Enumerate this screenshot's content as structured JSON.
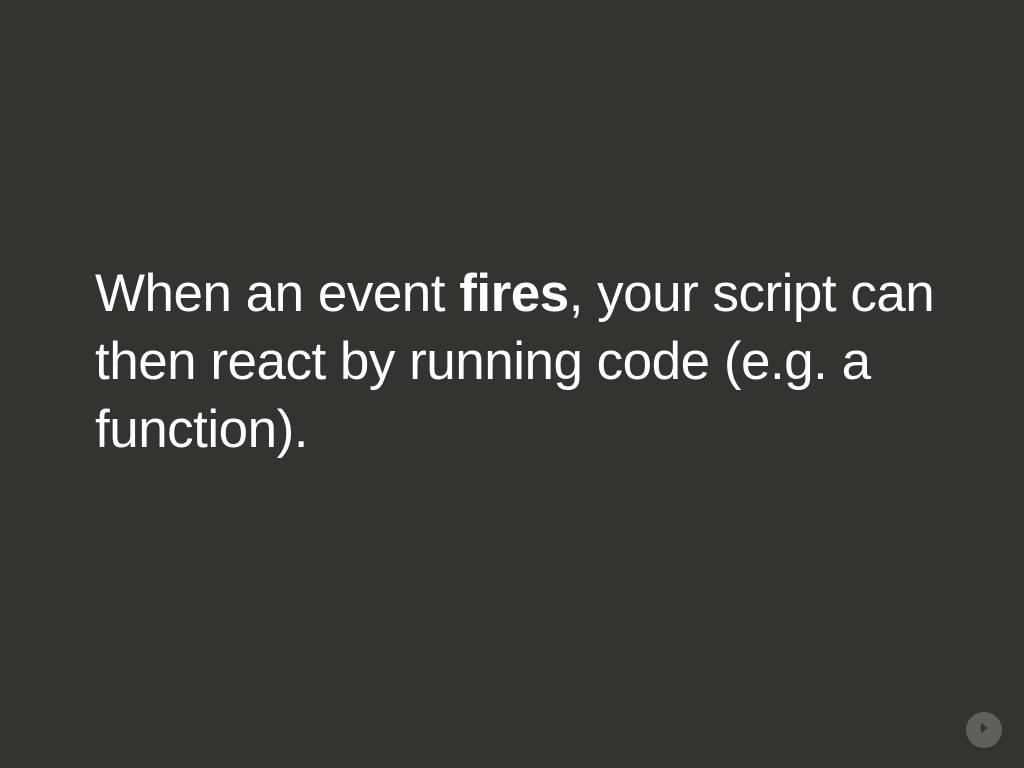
{
  "slide": {
    "text_before": "When an event ",
    "text_bold": "fires",
    "text_after": ", your script can then react by running code (e.g. a function)."
  },
  "navigation": {
    "next_label": "Next slide"
  }
}
